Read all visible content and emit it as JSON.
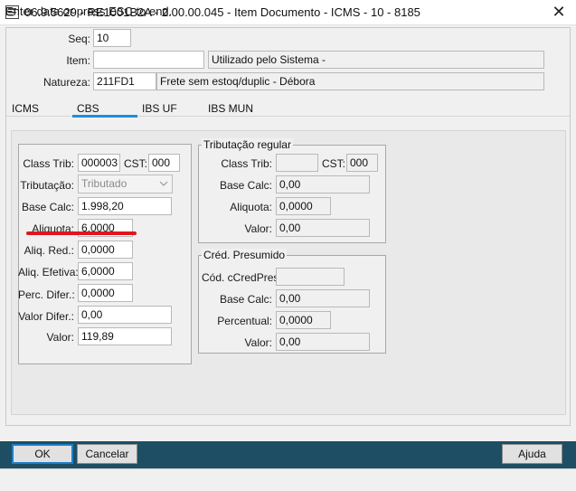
{
  "window": {
    "title": "06.9.5629 - RE1001B2A - 2.00.00.045 - Item Documento - ICMS - 10 - 8185",
    "close_glyph": "✕"
  },
  "header": {
    "seq": {
      "label": "Seq:",
      "value": "10"
    },
    "item": {
      "label": "Item:",
      "value": "",
      "description": "Utilizado pelo Sistema -"
    },
    "natureza": {
      "label": "Natureza:",
      "value": "211FD1",
      "description": "Frete sem estoq/duplic - Débora"
    }
  },
  "tabs": [
    {
      "label": "ICMS"
    },
    {
      "label": "CBS"
    },
    {
      "label": "IBS UF"
    },
    {
      "label": "IBS MUN"
    }
  ],
  "active_tab": "CBS",
  "accent_color": "#1e8fd6",
  "cbs": {
    "class_trib": {
      "label": "Class Trib:",
      "value": "000003"
    },
    "cst": {
      "label": "CST:",
      "value": "000"
    },
    "tributacao": {
      "label": "Tributação:",
      "value": "Tributado"
    },
    "base_calc": {
      "label": "Base Calc:",
      "value": "1.998,20"
    },
    "aliquota": {
      "label": "Aliquota:",
      "value": "6,0000"
    },
    "aliq_red": {
      "label": "Aliq. Red.:",
      "value": "0,0000"
    },
    "aliq_efetiva": {
      "label": "Aliq. Efetiva:",
      "value": "6,0000"
    },
    "perc_difer": {
      "label": "Perc. Difer.:",
      "value": "0,0000"
    },
    "valor_difer": {
      "label": "Valor Difer.:",
      "value": "0,00"
    },
    "valor": {
      "label": "Valor:",
      "value": "119,89"
    }
  },
  "tributacao_regular": {
    "title": "Tributação regular",
    "class_trib": {
      "label": "Class Trib:",
      "value": ""
    },
    "cst": {
      "label": "CST:",
      "value": "000"
    },
    "base_calc": {
      "label": "Base Calc:",
      "value": "0,00"
    },
    "aliquota": {
      "label": "Aliquota:",
      "value": "0,0000"
    },
    "valor": {
      "label": "Valor:",
      "value": "0,00"
    }
  },
  "cred_presumido": {
    "title": "Créd. Presumido",
    "cod_ccredpres": {
      "label": "Cód. cCredPres:",
      "value": ""
    },
    "base_calc": {
      "label": "Base Calc:",
      "value": "0,00"
    },
    "percentual": {
      "label": "Percentual:",
      "value": "0,0000"
    },
    "valor": {
      "label": "Valor:",
      "value": "0,00"
    }
  },
  "buttons": {
    "ok": "OK",
    "cancelar": "Cancelar",
    "ajuda": "Ajuda"
  },
  "status": "Enter data or press ESC to end.",
  "annotation_color": "#e0161b"
}
